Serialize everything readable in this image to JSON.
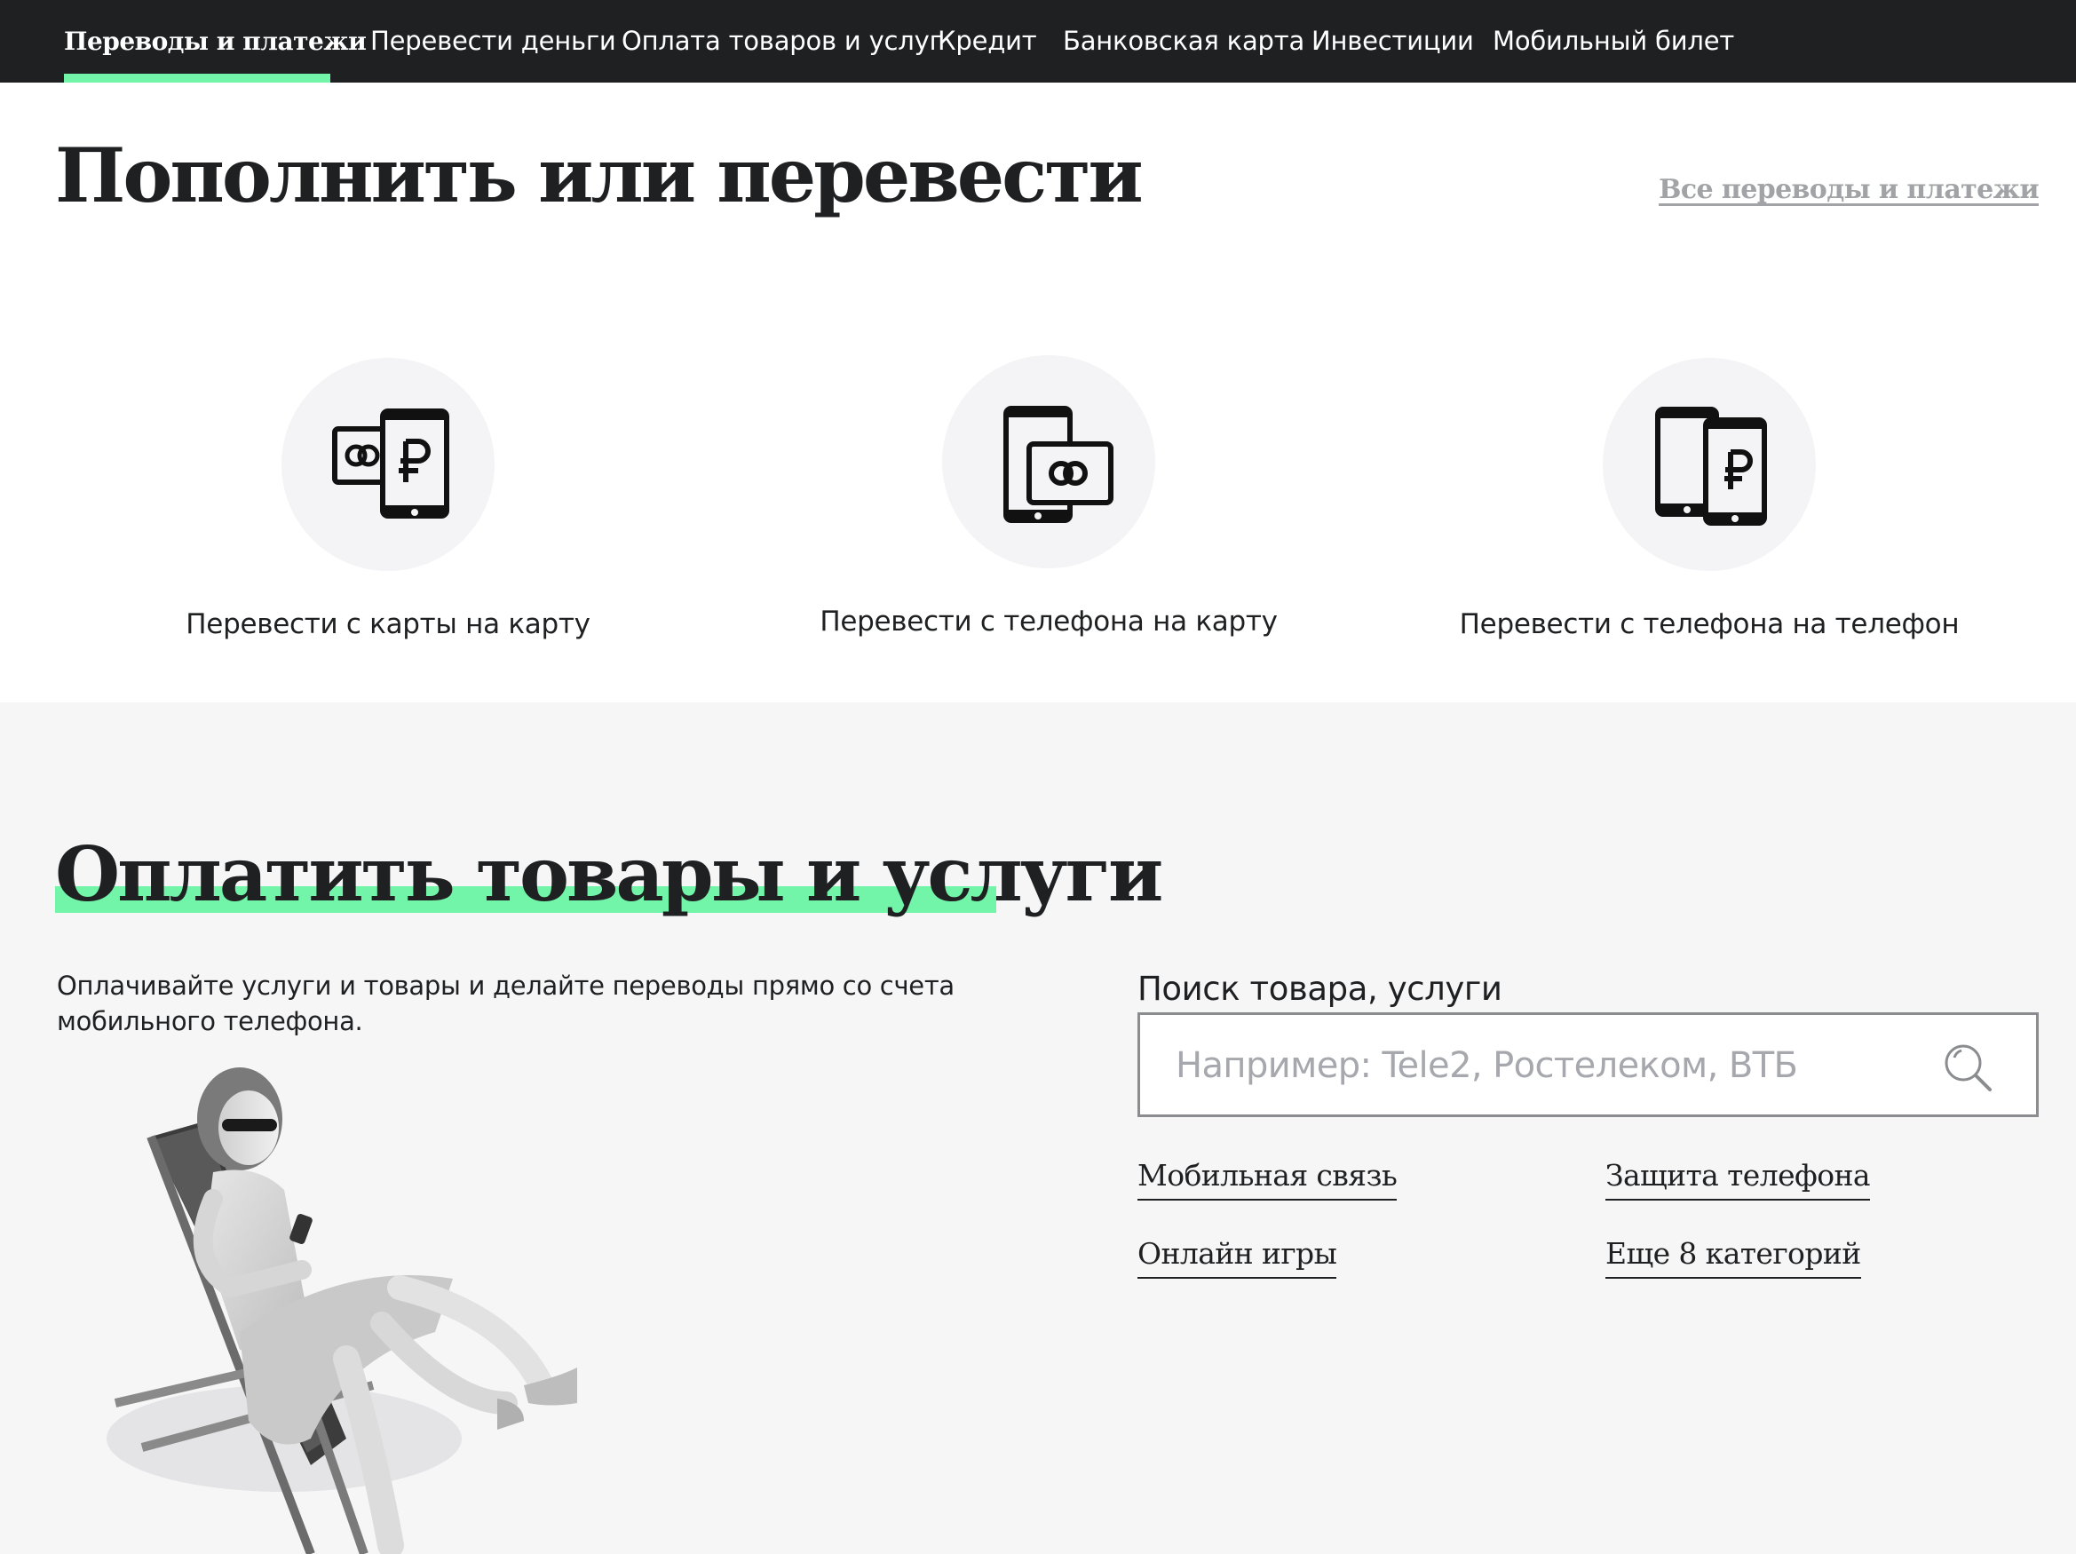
{
  "nav": {
    "items": [
      {
        "label": "Переводы и платежи",
        "active": true
      },
      {
        "label": "Перевести деньги"
      },
      {
        "label": "Оплата товаров и услуг"
      },
      {
        "label": "Кредит"
      },
      {
        "label": "Банковская карта"
      },
      {
        "label": "Инвестиции"
      },
      {
        "label": "Мобильный билет"
      }
    ]
  },
  "transfer": {
    "title": "Пополнить или перевести",
    "all_link": "Все переводы и платежи",
    "tiles": [
      {
        "label": "Перевести с карты на карту",
        "icon": "card-to-phone-ruble-icon"
      },
      {
        "label": "Перевести с телефона на карту",
        "icon": "phone-with-card-icon"
      },
      {
        "label": "Перевести с телефона на телефон",
        "icon": "two-phones-ruble-icon"
      }
    ]
  },
  "pay": {
    "title": "Оплатить товары и услуги",
    "description": "Оплачивайте услуги и товары и делайте переводы прямо со счета мобильного телефона.",
    "search": {
      "label": "Поиск товара, услуги",
      "placeholder": "Например: Tele2, Ростелеком, ВТБ",
      "value": ""
    },
    "categories": [
      "Мобильная связь",
      "Защита телефона",
      "Онлайн игры",
      "Еще 8 категорий"
    ]
  },
  "colors": {
    "accent": "#73f5a9",
    "nav_bg": "#1f2022",
    "text": "#1f2022",
    "muted": "#a1a3a6",
    "section_gray": "#f6f6f7"
  }
}
